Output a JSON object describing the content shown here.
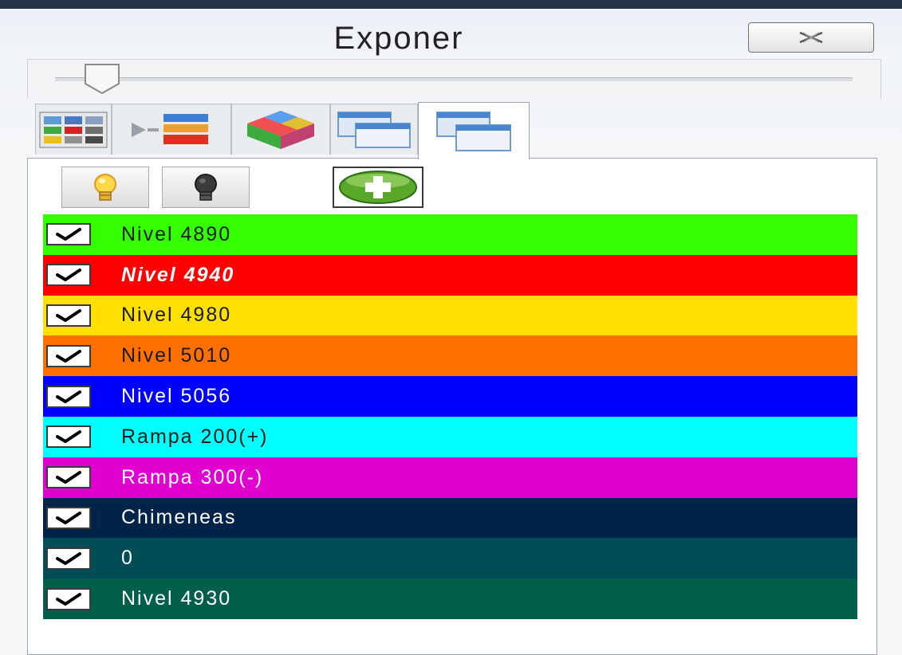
{
  "window": {
    "title": "Exponer",
    "close_icon": "close-x-icon"
  },
  "slider": {
    "value": 0.05
  },
  "tabs": [
    {
      "icon": "color-grid-icon",
      "active": false
    },
    {
      "icon": "layer-arrow-icon",
      "active": false
    },
    {
      "icon": "color-cube-icon",
      "active": false
    },
    {
      "icon": "windows-icon",
      "active": false
    },
    {
      "icon": "windows-icon",
      "active": true
    }
  ],
  "toolbar": [
    {
      "icon": "lightbulb-on-icon"
    },
    {
      "icon": "lightbulb-off-icon"
    },
    {
      "icon": "add-green-icon"
    }
  ],
  "layers": [
    {
      "label": "Nivel 4890",
      "color": "#33ff00",
      "text_color": "#1a1a1a",
      "checked": true,
      "italic": false
    },
    {
      "label": "Nivel 4940",
      "color": "#ff0000",
      "text_color": "#ffffff",
      "checked": true,
      "italic": true
    },
    {
      "label": "Nivel 4980",
      "color": "#ffe000",
      "text_color": "#1a1a1a",
      "checked": true,
      "italic": false
    },
    {
      "label": "Nivel 5010",
      "color": "#ff7000",
      "text_color": "#1a1a1a",
      "checked": true,
      "italic": false
    },
    {
      "label": "Nivel 5056",
      "color": "#0000ff",
      "text_color": "#ffffff",
      "checked": true,
      "italic": false
    },
    {
      "label": "Rampa 200(+)",
      "color": "#00ffff",
      "text_color": "#1a1a1a",
      "checked": true,
      "italic": false
    },
    {
      "label": "Rampa 300(-)",
      "color": "#e000d0",
      "text_color": "#ffffff",
      "checked": true,
      "italic": false
    },
    {
      "label": "Chimeneas",
      "color": "#00234a",
      "text_color": "#ffffff",
      "checked": true,
      "italic": false
    },
    {
      "label": "0",
      "color": "#004d57",
      "text_color": "#ffffff",
      "checked": true,
      "italic": false
    },
    {
      "label": "Nivel 4930",
      "color": "#005f4a",
      "text_color": "#ffffff",
      "checked": true,
      "italic": false
    }
  ]
}
